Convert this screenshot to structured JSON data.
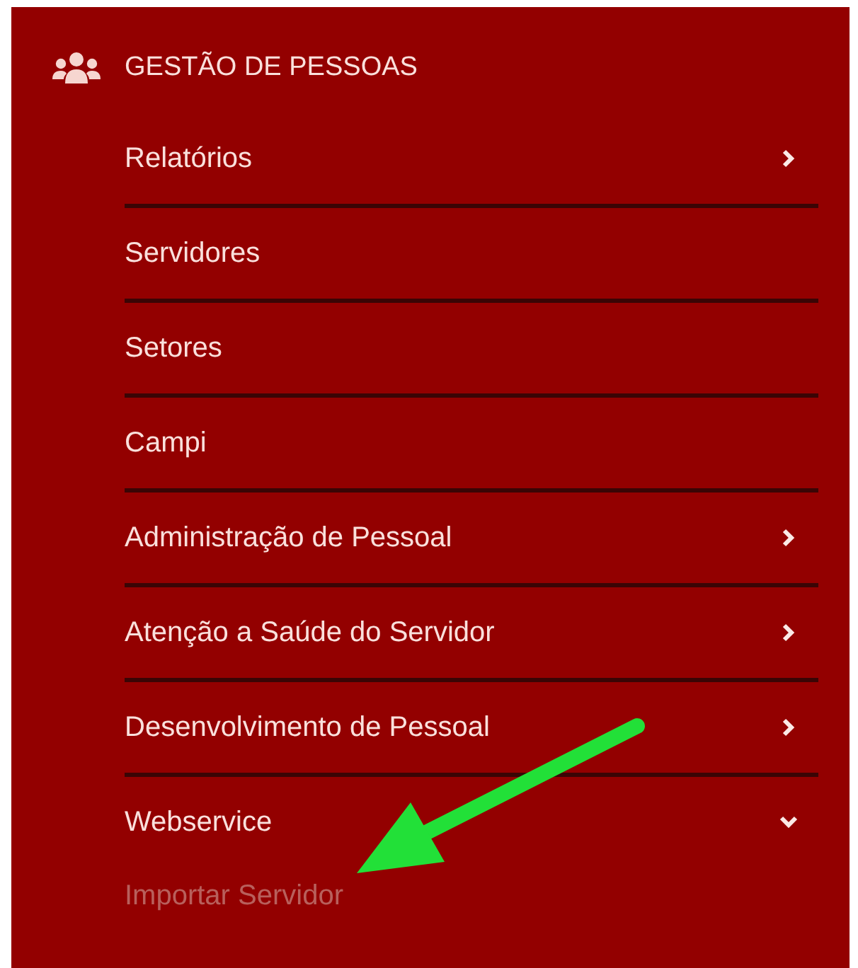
{
  "menu": {
    "title": "GESTÃO DE PESSOAS",
    "items": [
      {
        "label": "Relatórios",
        "has_submenu": true,
        "expanded": false
      },
      {
        "label": "Servidores",
        "has_submenu": false,
        "expanded": false
      },
      {
        "label": "Setores",
        "has_submenu": false,
        "expanded": false
      },
      {
        "label": "Campi",
        "has_submenu": false,
        "expanded": false
      },
      {
        "label": "Administração de Pessoal",
        "has_submenu": true,
        "expanded": false
      },
      {
        "label": "Atenção a Saúde do Servidor",
        "has_submenu": true,
        "expanded": false
      },
      {
        "label": "Desenvolvimento de Pessoal",
        "has_submenu": true,
        "expanded": false
      },
      {
        "label": "Webservice",
        "has_submenu": true,
        "expanded": true,
        "children": [
          {
            "label": "Importar Servidor"
          }
        ]
      }
    ]
  }
}
